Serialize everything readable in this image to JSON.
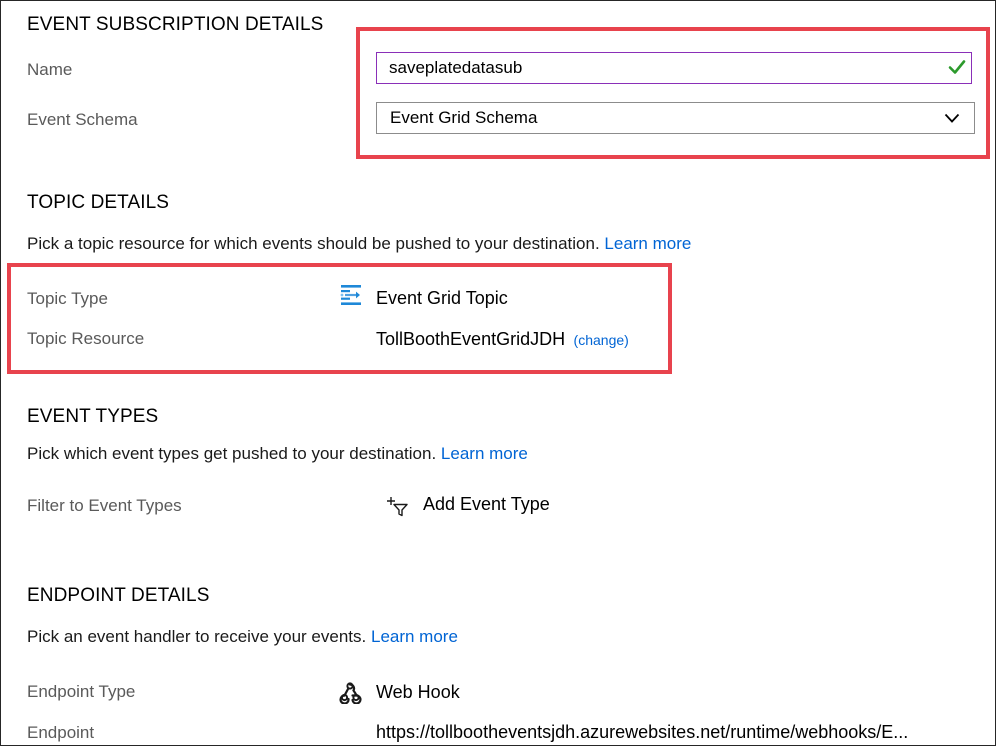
{
  "event_subscription": {
    "heading": "EVENT SUBSCRIPTION DETAILS",
    "name_label": "Name",
    "name_value": "saveplatedatasub",
    "schema_label": "Event Schema",
    "schema_value": "Event Grid Schema"
  },
  "topic": {
    "heading": "TOPIC DETAILS",
    "description": "Pick a topic resource for which events should be pushed to your destination.",
    "learn_more": "Learn more",
    "type_label": "Topic Type",
    "type_value": "Event Grid Topic",
    "resource_label": "Topic Resource",
    "resource_value": "TollBoothEventGridJDH",
    "change_link": "(change)"
  },
  "event_types": {
    "heading": "EVENT TYPES",
    "description": "Pick which event types get pushed to your destination.",
    "learn_more": "Learn more",
    "filter_label": "Filter to Event Types",
    "add_button": "Add Event Type"
  },
  "endpoint": {
    "heading": "ENDPOINT DETAILS",
    "description": "Pick an event handler to receive your events.",
    "learn_more": "Learn more",
    "type_label": "Endpoint Type",
    "type_value": "Web Hook",
    "endpoint_label": "Endpoint",
    "endpoint_value": "https://tollbootheventsjdh.azurewebsites.net/runtime/webhooks/E..."
  },
  "colors": {
    "highlight": "#e8434d",
    "link": "#0064d4",
    "input_border_focus": "#8a2fb8",
    "valid_check": "#2c9a2c"
  },
  "icons": [
    "check-icon",
    "chevron-down-icon",
    "event-grid-topic-icon",
    "add-filter-icon",
    "webhook-icon"
  ]
}
